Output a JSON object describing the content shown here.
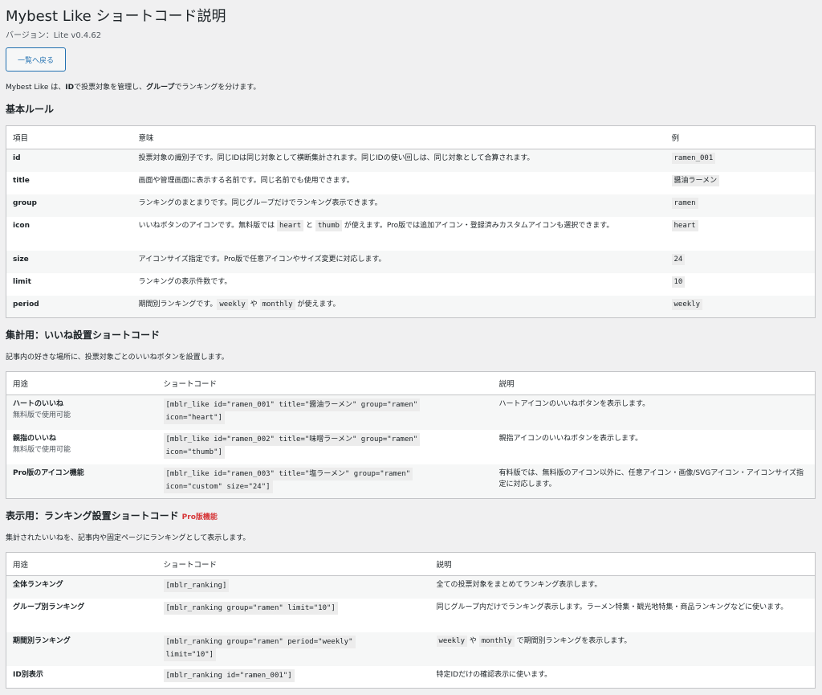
{
  "header": {
    "title": "Mybest Like ショートコード説明",
    "version": "バージョン：Lite v0.4.62",
    "back_button": "一覧へ戻る",
    "intro_pre": "Mybest Like は、",
    "intro_id": "ID",
    "intro_mid": "で投票対象を管理し、",
    "intro_group": "グループ",
    "intro_post": "でランキングを分けます。"
  },
  "basic": {
    "title": "基本ルール",
    "headers": [
      "項目",
      "意味",
      "例"
    ],
    "rows": [
      {
        "key": "id",
        "meaning": "投票対象の識別子です。同じIDは同じ対象として横断集計されます。同じIDの使い回しは、同じ対象として合算されます。",
        "example": "ramen_001"
      },
      {
        "key": "title",
        "meaning": "画面や管理画面に表示する名前です。同じ名前でも使用できます。",
        "example": "醤油ラーメン"
      },
      {
        "key": "group",
        "meaning": "ランキングのまとまりです。同じグループだけでランキング表示できます。",
        "example": "ramen"
      },
      {
        "key": "icon",
        "meaning_pre": "いいねボタンのアイコンです。無料版では ",
        "meaning_c1": "heart",
        "meaning_mid": " と ",
        "meaning_c2": "thumb",
        "meaning_post": " が使えます。Pro版では追加アイコン・登録済みカスタムアイコンも選択できます。",
        "example": "heart"
      },
      {
        "key": "size",
        "meaning": "アイコンサイズ指定です。Pro版で任意アイコンやサイズ変更に対応します。",
        "example": "24"
      },
      {
        "key": "limit",
        "meaning": "ランキングの表示件数です。",
        "example": "10"
      },
      {
        "key": "period",
        "meaning_pre": "期間別ランキングです。",
        "meaning_c1": "weekly",
        "meaning_mid": " や ",
        "meaning_c2": "monthly",
        "meaning_post": " が使えます。",
        "example": "weekly"
      }
    ]
  },
  "like": {
    "title": "集計用：いいね設置ショートコード",
    "desc": "記事内の好きな場所に、投票対象ごとのいいねボタンを設置します。",
    "headers": [
      "用途",
      "ショートコード",
      "説明"
    ],
    "rows": [
      {
        "use": "ハートのいいね",
        "sub": "無料版で使用可能",
        "code1": "[mblr_like id=\"ramen_001\" title=\"醤油ラーメン\" group=\"ramen\"",
        "code2": "icon=\"heart\"]",
        "desc": "ハートアイコンのいいねボタンを表示します。"
      },
      {
        "use": "親指のいいね",
        "sub": "無料版で使用可能",
        "code1": "[mblr_like id=\"ramen_002\" title=\"味噌ラーメン\" group=\"ramen\"",
        "code2": "icon=\"thumb\"]",
        "desc": "親指アイコンのいいねボタンを表示します。"
      },
      {
        "use": "Pro版のアイコン機能",
        "sub": "",
        "code1": "[mblr_like id=\"ramen_003\" title=\"塩ラーメン\" group=\"ramen\"",
        "code2": "icon=\"custom\" size=\"24\"]",
        "desc": "有料版では、無料版のアイコン以外に、任意アイコン・画像/SVGアイコン・アイコンサイズ指定に対応します。"
      }
    ]
  },
  "ranking": {
    "title": "表示用：ランキング設置ショートコード",
    "pro_badge": "Pro版機能",
    "desc": "集計されたいいねを、記事内や固定ページにランキングとして表示します。",
    "headers": [
      "用途",
      "ショートコード",
      "説明"
    ],
    "rows": [
      {
        "use": "全体ランキング",
        "code1": "[mblr_ranking]",
        "code2": "",
        "desc": "全ての投票対象をまとめてランキング表示します。"
      },
      {
        "use": "グループ別ランキング",
        "code1": "[mblr_ranking group=\"ramen\" limit=\"10\"]",
        "code2": "",
        "desc": "同じグループ内だけでランキング表示します。ラーメン特集・観光地特集・商品ランキングなどに使います。"
      },
      {
        "use": "期間別ランキング",
        "code1": "[mblr_ranking group=\"ramen\" period=\"weekly\"",
        "code2": "limit=\"10\"]",
        "desc_c1": "weekly",
        "desc_mid": " や ",
        "desc_c2": "monthly",
        "desc_post": " で期間別ランキングを表示します。"
      },
      {
        "use": "ID別表示",
        "code1": "[mblr_ranking id=\"ramen_001\"]",
        "code2": "",
        "desc": "特定IDだけの確認表示に使います。"
      }
    ]
  }
}
